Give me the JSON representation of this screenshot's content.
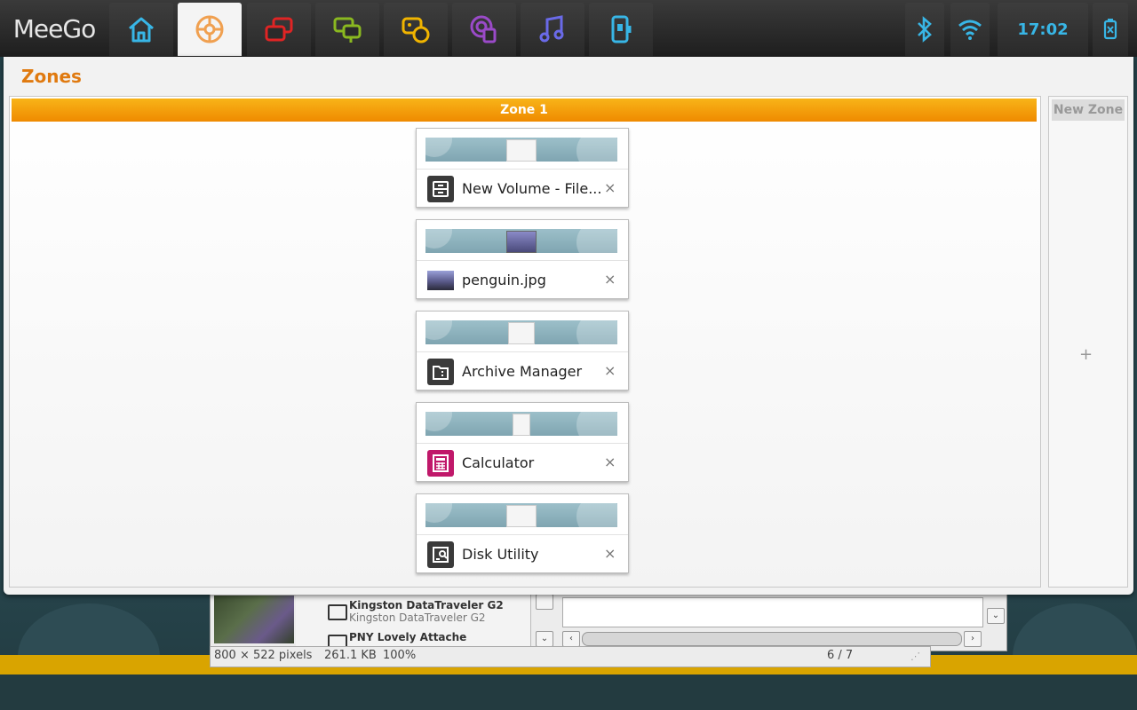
{
  "top_panel": {
    "logo": "MeeGo",
    "clock": "17:02",
    "tabs": [
      {
        "name": "home-icon",
        "color": "#38b6e6"
      },
      {
        "name": "zones-icon",
        "color": "#f0a050"
      },
      {
        "name": "apps-icon",
        "color": "#e02424"
      },
      {
        "name": "chat-icon",
        "color": "#8ab820"
      },
      {
        "name": "people-icon",
        "color": "#f0b400"
      },
      {
        "name": "internet-icon",
        "color": "#9a4ac8"
      },
      {
        "name": "music-icon",
        "color": "#6a6ae8"
      },
      {
        "name": "device-icon",
        "color": "#38b6e6"
      }
    ]
  },
  "zones": {
    "title": "Zones",
    "zone1": {
      "title": "Zone 1",
      "apps": [
        {
          "label": "New Volume - File...",
          "icon": "file-manager-icon"
        },
        {
          "label": "penguin.jpg",
          "icon": "image-viewer-icon"
        },
        {
          "label": "Archive Manager",
          "icon": "archive-manager-icon"
        },
        {
          "label": "Calculator",
          "icon": "calculator-icon"
        },
        {
          "label": "Disk Utility",
          "icon": "disk-utility-icon"
        }
      ],
      "close_glyph": "×"
    },
    "new_zone": {
      "title": "New Zone",
      "plus": "+"
    }
  },
  "background": {
    "devices": [
      {
        "title": "Kingston DataTraveler G2",
        "subtitle": "Kingston DataTraveler G2"
      },
      {
        "title": "PNY Lovely Attache",
        "subtitle": ""
      }
    ],
    "status": {
      "dimensions": "800 × 522 pixels",
      "size": "261.1 KB",
      "zoom": "100%",
      "position": "6 / 7"
    }
  }
}
